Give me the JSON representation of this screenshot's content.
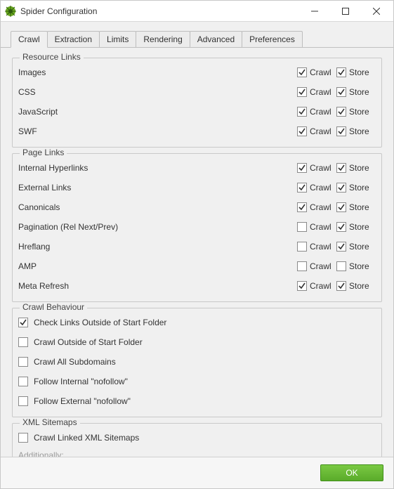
{
  "window": {
    "title": "Spider Configuration",
    "ok_label": "OK"
  },
  "tabs": [
    {
      "label": "Crawl",
      "active": true
    },
    {
      "label": "Extraction",
      "active": false
    },
    {
      "label": "Limits",
      "active": false
    },
    {
      "label": "Rendering",
      "active": false
    },
    {
      "label": "Advanced",
      "active": false
    },
    {
      "label": "Preferences",
      "active": false
    }
  ],
  "col_labels": {
    "crawl": "Crawl",
    "store": "Store"
  },
  "groups": {
    "resource_links": {
      "legend": "Resource Links",
      "rows": [
        {
          "label": "Images",
          "crawl": true,
          "store": true
        },
        {
          "label": "CSS",
          "crawl": true,
          "store": true
        },
        {
          "label": "JavaScript",
          "crawl": true,
          "store": true
        },
        {
          "label": "SWF",
          "crawl": true,
          "store": true
        }
      ]
    },
    "page_links": {
      "legend": "Page Links",
      "rows": [
        {
          "label": "Internal Hyperlinks",
          "crawl": true,
          "store": true
        },
        {
          "label": "External Links",
          "crawl": true,
          "store": true
        },
        {
          "label": "Canonicals",
          "crawl": true,
          "store": true
        },
        {
          "label": "Pagination (Rel Next/Prev)",
          "crawl": false,
          "store": true
        },
        {
          "label": "Hreflang",
          "crawl": false,
          "store": true
        },
        {
          "label": "AMP",
          "crawl": false,
          "store": false
        },
        {
          "label": "Meta Refresh",
          "crawl": true,
          "store": true
        }
      ]
    },
    "crawl_behaviour": {
      "legend": "Crawl Behaviour",
      "rows": [
        {
          "label": "Check Links Outside of Start Folder",
          "checked": true
        },
        {
          "label": "Crawl Outside of Start Folder",
          "checked": false
        },
        {
          "label": "Crawl All Subdomains",
          "checked": false
        },
        {
          "label": "Follow Internal \"nofollow\"",
          "checked": false
        },
        {
          "label": "Follow External \"nofollow\"",
          "checked": false
        }
      ]
    },
    "xml_sitemaps": {
      "legend": "XML Sitemaps",
      "rows": [
        {
          "label": "Crawl Linked XML Sitemaps",
          "checked": false
        }
      ],
      "additionally_label": "Additionally:"
    }
  }
}
